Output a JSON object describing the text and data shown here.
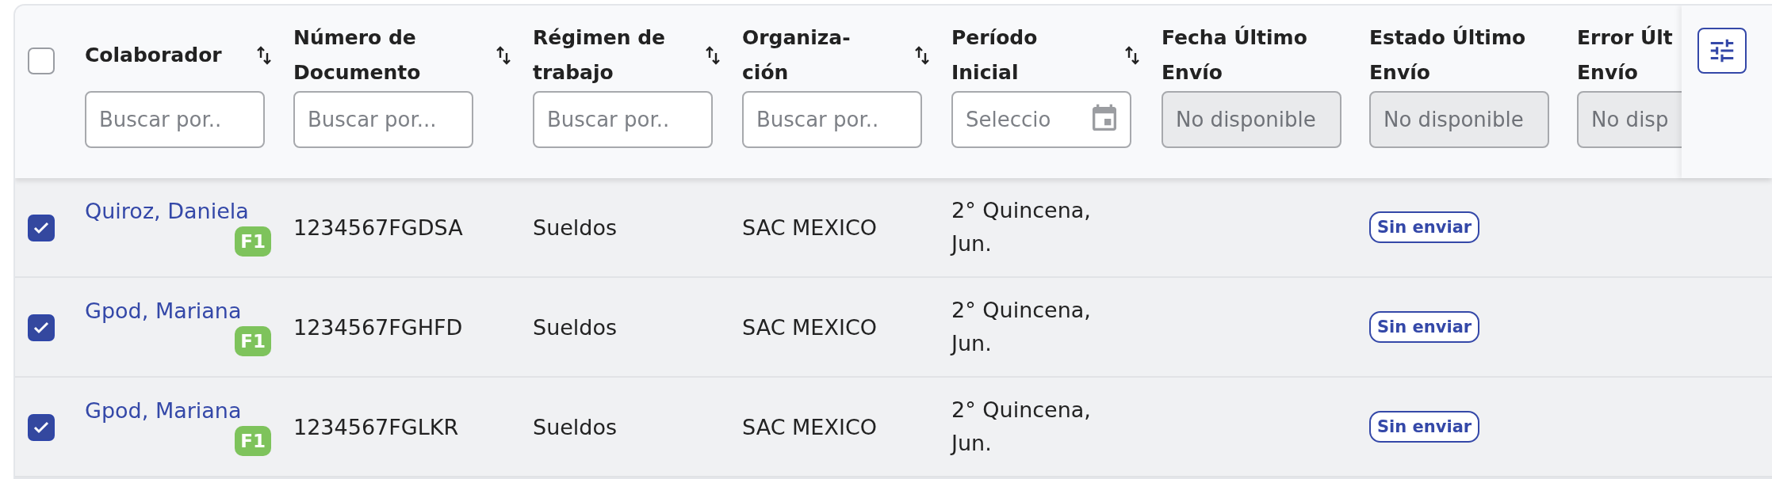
{
  "select_all": {
    "checked": false
  },
  "columns": [
    {
      "lines": [
        "Colaborador"
      ],
      "sortable": true,
      "filter": {
        "kind": "text",
        "placeholder": "Buscar por..",
        "disabled": false
      }
    },
    {
      "lines": [
        "Número de",
        "Documento"
      ],
      "sortable": true,
      "filter": {
        "kind": "text",
        "placeholder": "Buscar por...",
        "disabled": false
      }
    },
    {
      "lines": [
        "Régimen de",
        "trabajo"
      ],
      "sortable": true,
      "filter": {
        "kind": "text",
        "placeholder": "Buscar por..",
        "disabled": false
      }
    },
    {
      "lines": [
        "Organiza-",
        "ción"
      ],
      "sortable": true,
      "filter": {
        "kind": "text",
        "placeholder": "Buscar por..",
        "disabled": false
      }
    },
    {
      "lines": [
        "Período",
        "Inicial"
      ],
      "sortable": true,
      "filter": {
        "kind": "date",
        "placeholder": "Seleccio",
        "disabled": false
      }
    },
    {
      "lines": [
        "Fecha Último",
        "Envío"
      ],
      "sortable": false,
      "filter": {
        "kind": "text",
        "placeholder": "No disponible",
        "disabled": true
      }
    },
    {
      "lines": [
        "Estado Último",
        "Envío"
      ],
      "sortable": false,
      "filter": {
        "kind": "text",
        "placeholder": "No disponible",
        "disabled": true
      }
    },
    {
      "lines": [
        "Error Últ",
        "Envío"
      ],
      "sortable": false,
      "filter": {
        "kind": "text",
        "placeholder": "No disp",
        "disabled": true
      }
    }
  ],
  "rows": [
    {
      "selected": true,
      "name": "Quiroz, Daniela",
      "badge": "F1",
      "document": "1234567FGDSA",
      "regime": "Sueldos",
      "organization": "SAC MEXICO",
      "period": [
        "2° Quincena,",
        "Jun."
      ],
      "status": "Sin enviar"
    },
    {
      "selected": true,
      "name": "Gpod, Mariana",
      "badge": "F1",
      "document": "1234567FGHFD",
      "regime": "Sueldos",
      "organization": "SAC MEXICO",
      "period": [
        "2° Quincena,",
        "Jun."
      ],
      "status": "Sin enviar"
    },
    {
      "selected": true,
      "name": "Gpod, Mariana",
      "badge": "F1",
      "document": "1234567FGLKR",
      "regime": "Sueldos",
      "organization": "SAC MEXICO",
      "period": [
        "2° Quincena,",
        "Jun."
      ],
      "status": "Sin enviar"
    }
  ]
}
